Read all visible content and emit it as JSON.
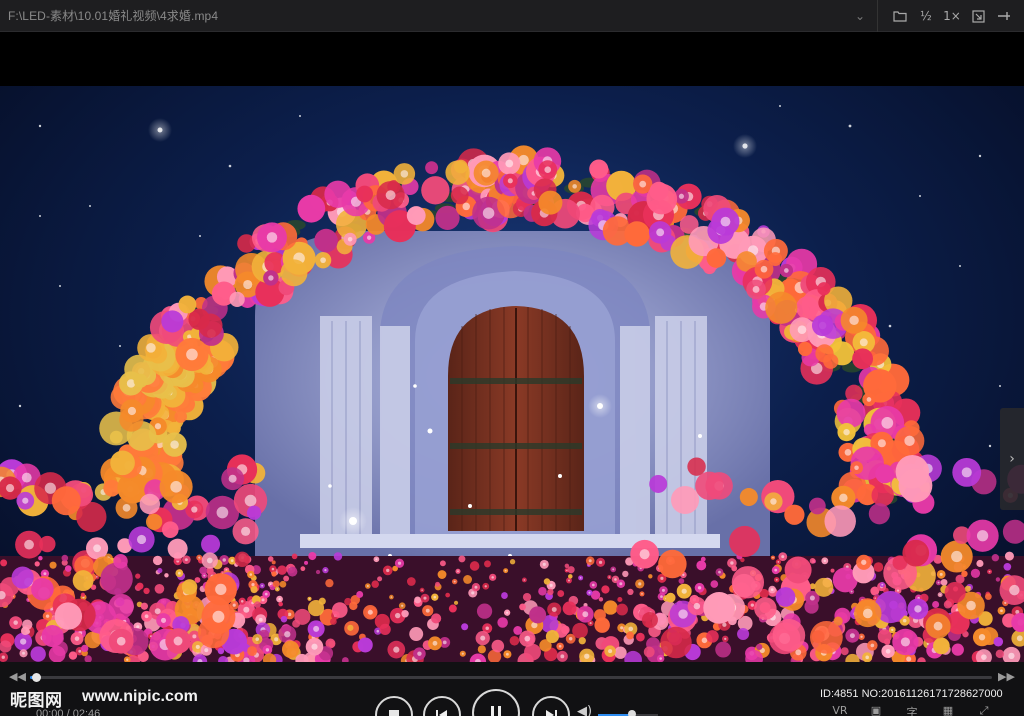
{
  "titlebar": {
    "path": "F:\\LED-素材\\10.01婚礼视频\\4求婚.mp4",
    "dropdown_icon": "chevron-down-icon",
    "icons": [
      {
        "name": "folder-icon",
        "glyph": "🗀"
      },
      {
        "name": "half-speed-icon",
        "glyph": "½"
      },
      {
        "name": "one-x-speed-icon",
        "glyph": "1×"
      },
      {
        "name": "fullscreen-exit-icon",
        "glyph": "⇲"
      },
      {
        "name": "pin-icon",
        "glyph": "⊣"
      }
    ]
  },
  "player": {
    "current_time": "00:00",
    "total_time": "02:46",
    "progress_fraction": 0.004,
    "volume_fraction": 0.55,
    "accent_color": "#2d8cf0",
    "right_controls": [
      {
        "name": "vr-icon",
        "label": "VR"
      },
      {
        "name": "screenshot-icon",
        "label": "▣"
      },
      {
        "name": "subtitle-icon",
        "label": "字"
      },
      {
        "name": "window-mode-icon",
        "label": "▦"
      },
      {
        "name": "fullscreen-icon",
        "label": "⤢"
      }
    ]
  },
  "watermark": {
    "site_name": "昵图网",
    "url": "www.nipic.com",
    "id_text": "ID:4851 NO:20161126171728627000"
  }
}
